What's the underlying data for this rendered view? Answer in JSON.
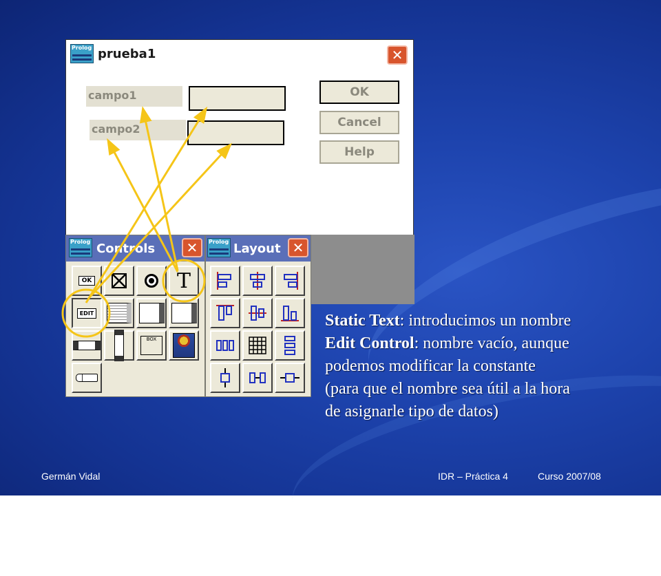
{
  "dialog": {
    "icon_label": "Prolog",
    "title": "prueba1",
    "close_glyph": "✕",
    "static_fields": [
      "campo1",
      "campo2"
    ],
    "buttons": {
      "ok": "OK",
      "cancel": "Cancel",
      "help": "Help"
    }
  },
  "controls_panel": {
    "icon_label": "Prolog",
    "title": "Controls",
    "close_glyph": "✕"
  },
  "layout_panel": {
    "icon_label": "Prolog",
    "title": "Layout",
    "close_glyph": "✕"
  },
  "tools": {
    "ok_button": "OK",
    "edit_button": "EDIT",
    "box_group": "BOX",
    "text_tool": "T"
  },
  "note": {
    "line1_bold": "Static Text",
    "line1_rest": ": introducimos un nombre",
    "line2_bold": "Edit Control",
    "line2_rest": ": nombre vacío, aunque",
    "line3": "podemos modificar la constante",
    "line4": "(para que el nombre sea útil a la hora",
    "line5": "de asignarle tipo de datos)"
  },
  "footer": {
    "author": "Germán Vidal",
    "course": "IDR – Práctica 4",
    "year": "Curso 2007/08"
  },
  "colors": {
    "arrow": "#f5c518",
    "background": "#1d43ad",
    "close": "#d8552d"
  }
}
